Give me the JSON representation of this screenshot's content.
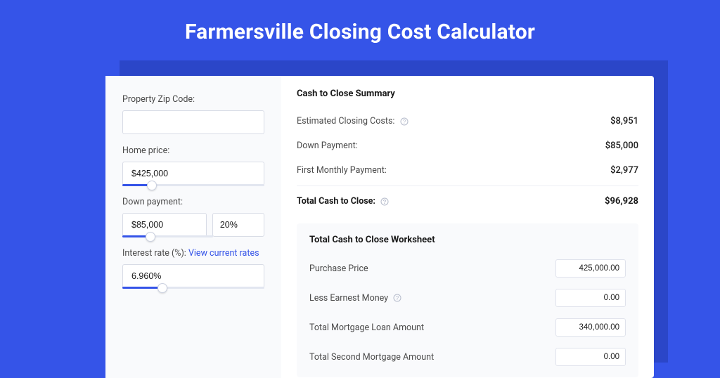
{
  "title": "Farmersville Closing Cost Calculator",
  "left": {
    "zip": {
      "label": "Property Zip Code:",
      "value": ""
    },
    "home_price": {
      "label": "Home price:",
      "value": "$425,000",
      "slider_pct": 21
    },
    "down_payment": {
      "label": "Down payment:",
      "value": "$85,000",
      "pct": "20%",
      "slider_pct": 20
    },
    "interest": {
      "label_prefix": "Interest rate (%): ",
      "link": "View current rates",
      "value": "6.960%",
      "slider_pct": 28
    }
  },
  "summary": {
    "title": "Cash to Close Summary",
    "rows": [
      {
        "label": "Estimated Closing Costs:",
        "help": true,
        "value": "$8,951"
      },
      {
        "label": "Down Payment:",
        "help": false,
        "value": "$85,000"
      },
      {
        "label": "First Monthly Payment:",
        "help": false,
        "value": "$2,977"
      }
    ],
    "total": {
      "label": "Total Cash to Close:",
      "help": true,
      "value": "$96,928"
    }
  },
  "worksheet": {
    "title": "Total Cash to Close Worksheet",
    "rows": [
      {
        "label": "Purchase Price",
        "help": false,
        "value": "425,000.00"
      },
      {
        "label": "Less Earnest Money",
        "help": true,
        "value": "0.00"
      },
      {
        "label": "Total Mortgage Loan Amount",
        "help": false,
        "value": "340,000.00"
      },
      {
        "label": "Total Second Mortgage Amount",
        "help": false,
        "value": "0.00"
      }
    ]
  }
}
